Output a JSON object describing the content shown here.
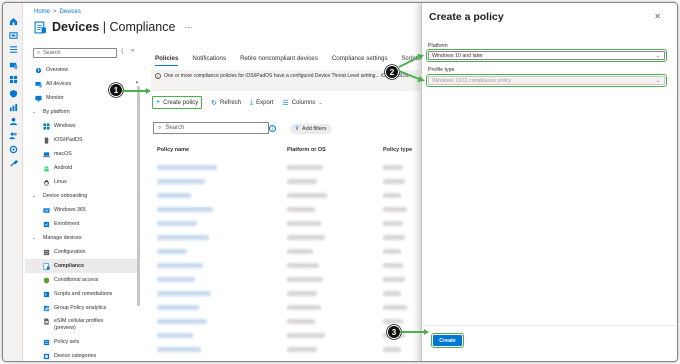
{
  "breadcrumb": {
    "home": "Home",
    "sep": ">",
    "devices": "Devices"
  },
  "header": {
    "title_bold": "Devices",
    "title_rest": " | Compliance",
    "more": "···"
  },
  "nav": {
    "search_placeholder": "Search",
    "collapse": "«",
    "items": [
      {
        "label": "Overview",
        "icon": "overview-icon",
        "level": "l0"
      },
      {
        "label": "All devices",
        "icon": "devices-icon",
        "level": "l0"
      },
      {
        "label": "Monitor",
        "icon": "monitor-icon",
        "level": "l0"
      },
      {
        "label": "By platform",
        "icon": "chevron-down-icon",
        "level": "group"
      },
      {
        "label": "Windows",
        "icon": "windows-icon",
        "level": "l1"
      },
      {
        "label": "iOS/iPadOS",
        "icon": "phone-icon",
        "level": "l1"
      },
      {
        "label": "macOS",
        "icon": "laptop-icon",
        "level": "l1"
      },
      {
        "label": "Android",
        "icon": "android-icon",
        "level": "l1"
      },
      {
        "label": "Linux",
        "icon": "linux-icon",
        "level": "l1"
      },
      {
        "label": "Device onboarding",
        "icon": "chevron-down-icon",
        "level": "group"
      },
      {
        "label": "Windows 365",
        "icon": "cloud-pc-icon",
        "level": "l1"
      },
      {
        "label": "Enrollment",
        "icon": "enrollment-icon",
        "level": "l1"
      },
      {
        "label": "Manage devices",
        "icon": "chevron-down-icon",
        "level": "group"
      },
      {
        "label": "Configuration",
        "icon": "configuration-icon",
        "level": "l1"
      },
      {
        "label": "Compliance",
        "icon": "compliance-icon",
        "level": "l1",
        "active": true
      },
      {
        "label": "Conditional access",
        "icon": "shield-icon",
        "level": "l1"
      },
      {
        "label": "Scripts and remediations",
        "icon": "script-icon",
        "level": "l1"
      },
      {
        "label": "Group Policy analytics",
        "icon": "analytics-icon",
        "level": "l1"
      },
      {
        "label": "eSIM cellular profiles (preview)",
        "icon": "esim-icon",
        "level": "l1",
        "two": true
      },
      {
        "label": "Policy sets",
        "icon": "policy-sets-icon",
        "level": "l1"
      },
      {
        "label": "Device categories",
        "icon": "categories-icon",
        "level": "l1"
      }
    ]
  },
  "main": {
    "tabs": [
      "Policies",
      "Notifications",
      "Retire noncompliant devices",
      "Compliance settings",
      "Scripts"
    ],
    "banner": "One or more compliance policies for iOS/iPadOS have a configured Device Threat Level setting... iOS/iPadOS.",
    "toolbar": {
      "create": "Create policy",
      "refresh": "Refresh",
      "export": "Export",
      "columns": "Columns"
    },
    "search_placeholder": "Search",
    "filter": "Add filters",
    "columns": [
      "Policy name",
      "Platform or OS",
      "Policy type"
    ]
  },
  "panel": {
    "title": "Create a policy",
    "platform_label": "Platform",
    "platform_value": "Windows 10 and later",
    "profile_label": "Profile type",
    "profile_value": "Windows 10/11 compliance policy",
    "create_button": "Create"
  },
  "callouts": [
    "1",
    "2",
    "3"
  ],
  "colors": {
    "accent": "#0078d4",
    "highlight": "#4caf50",
    "callout": "#111111"
  }
}
